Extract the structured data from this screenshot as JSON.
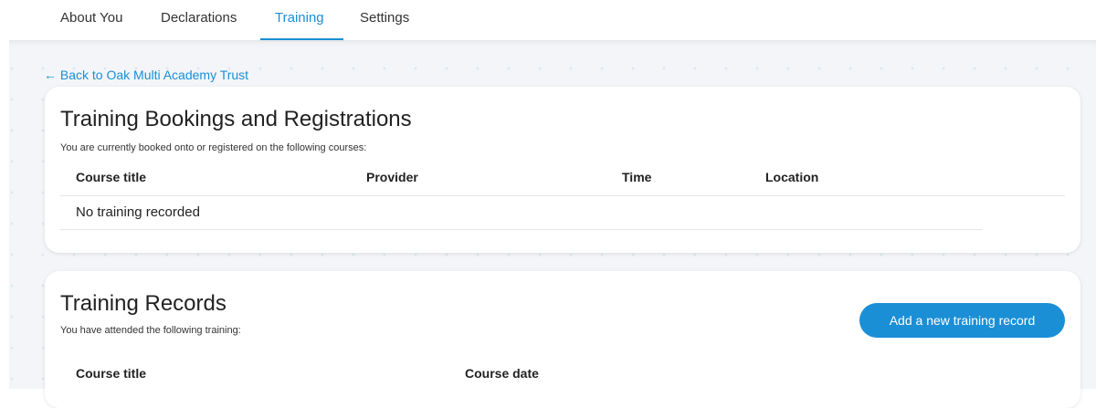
{
  "nav": {
    "tabs": [
      {
        "label": "About You"
      },
      {
        "label": "Declarations"
      },
      {
        "label": "Training"
      },
      {
        "label": "Settings"
      }
    ],
    "active_tab": "Training"
  },
  "back_link": "← Back to Oak Multi Academy Trust",
  "bookings": {
    "title": "Training Bookings and Registrations",
    "subtitle": "You are currently booked onto or registered on the following courses:",
    "columns": [
      "Course title",
      "Provider",
      "Time",
      "Location"
    ],
    "empty_message": "No training recorded"
  },
  "records": {
    "title": "Training Records",
    "subtitle": "You have attended the following training:",
    "add_button": "Add a new training record",
    "columns": [
      "Course title",
      "Course date"
    ]
  },
  "colors": {
    "accent": "#1a8fd6",
    "background": "#f3f5f8"
  }
}
